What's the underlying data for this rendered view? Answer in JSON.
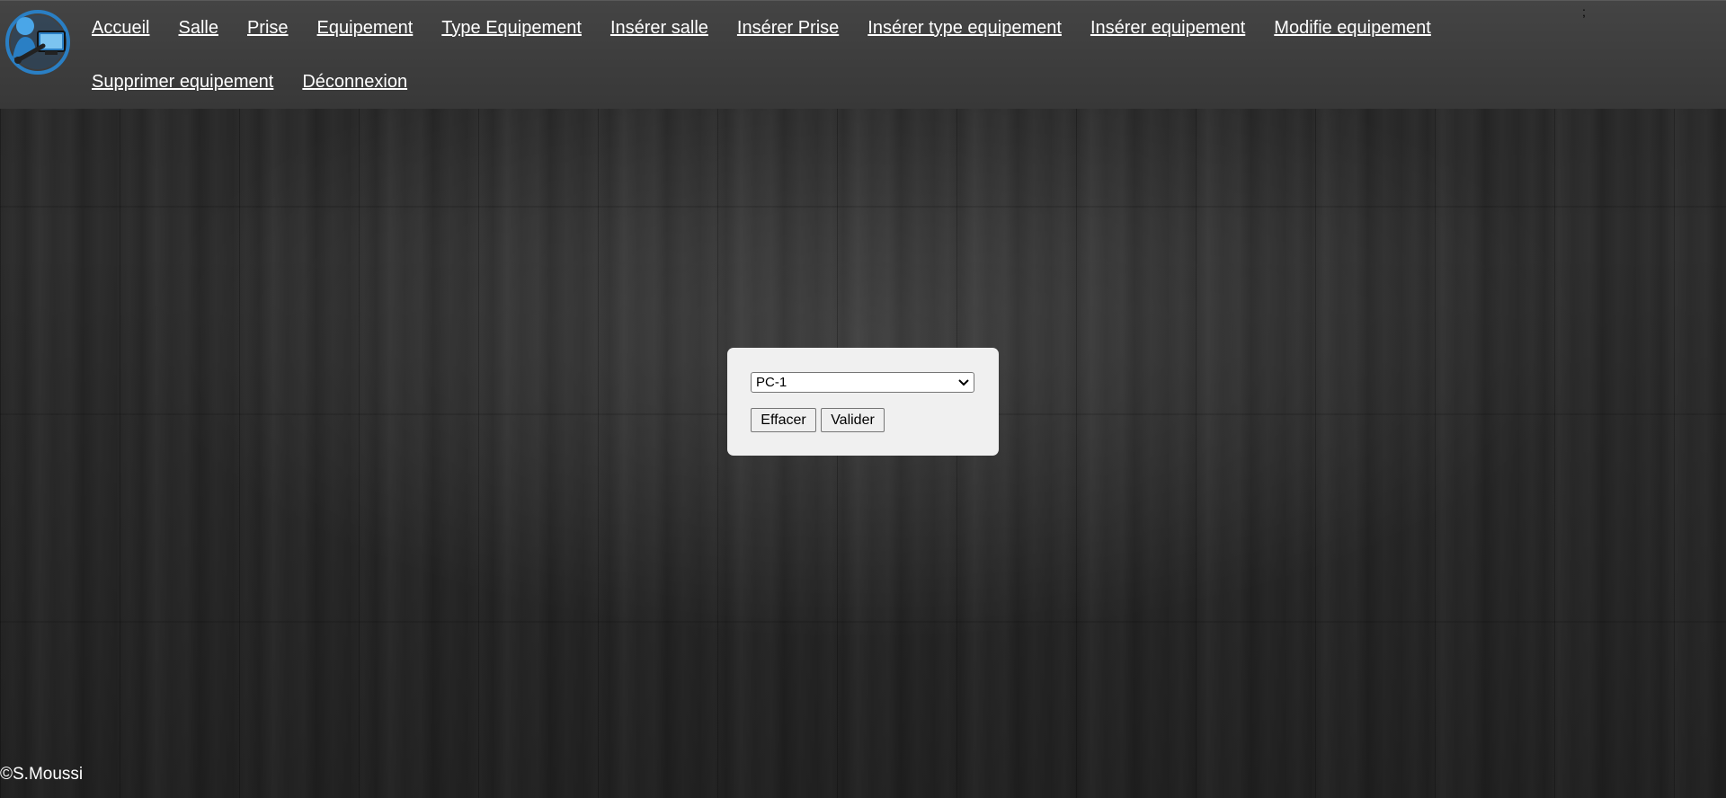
{
  "nav": {
    "row1": [
      {
        "label": "Accueil",
        "name": "nav-link-accueil"
      },
      {
        "label": "Salle",
        "name": "nav-link-salle"
      },
      {
        "label": "Prise",
        "name": "nav-link-prise"
      },
      {
        "label": "Equipement",
        "name": "nav-link-equipement"
      },
      {
        "label": "Type Equipement",
        "name": "nav-link-type-equipement"
      },
      {
        "label": "Insérer salle",
        "name": "nav-link-inserer-salle"
      },
      {
        "label": "Insérer Prise",
        "name": "nav-link-inserer-prise"
      },
      {
        "label": "Insérer type equipement",
        "name": "nav-link-inserer-type-equipement"
      },
      {
        "label": "Insérer equipement",
        "name": "nav-link-inserer-equipement"
      },
      {
        "label": "Modifie equipement",
        "name": "nav-link-modifie-equipement"
      }
    ],
    "row2": [
      {
        "label": "Supprimer equipement",
        "name": "nav-link-supprimer-equipement"
      },
      {
        "label": "Déconnexion",
        "name": "nav-link-deconnexion"
      }
    ],
    "stray_mark": ";"
  },
  "form": {
    "select_value": "PC-1",
    "clear_label": "Effacer",
    "submit_label": "Valider"
  },
  "footer": {
    "copyright": "©S.Moussi"
  },
  "colors": {
    "navbar": "#3e3e3e",
    "panel": "#f0f0f0",
    "logo_blue": "#2a7fc4"
  },
  "icons": {
    "logo": "network-admin-logo",
    "select": "chevron-down-icon"
  }
}
